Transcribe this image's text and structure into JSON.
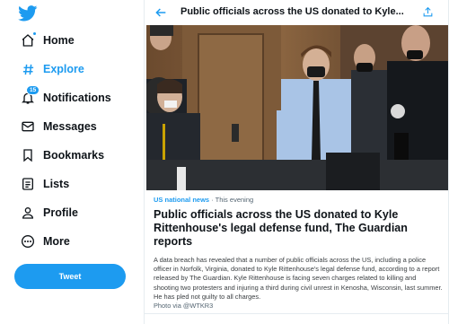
{
  "nav": {
    "home": "Home",
    "explore": "Explore",
    "notifications": "Notifications",
    "notifications_badge": "15",
    "messages": "Messages",
    "bookmarks": "Bookmarks",
    "lists": "Lists",
    "profile": "Profile",
    "more": "More"
  },
  "tweet_button": "Tweet",
  "header": {
    "title": "Public officials across the US donated to Kyle..."
  },
  "article": {
    "category": "US national news",
    "time": " · This evening",
    "headline": "Public officials across the US donated to Kyle Rittenhouse's legal defense fund, The Guardian reports",
    "body": "A data breach has revealed that a number of public officials across the US, including a police officer in Norfolk, Virginia, donated to Kyle Rittenhouse's legal defense fund, according to a report released by The Guardian. Kyle Rittenhouse is facing seven charges related to killing and shooting two protesters and injuring a third during civil unrest in Kenosha, Wisconsin, last summer. He has pled not guilty to all charges.",
    "credit": "Photo via @WTKR3"
  },
  "colors": {
    "accent": "#1d9bf0",
    "text": "#0f1419",
    "muted": "#536471"
  }
}
